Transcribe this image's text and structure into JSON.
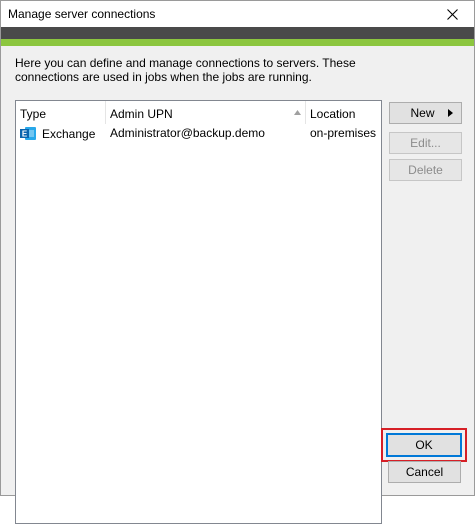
{
  "window": {
    "title": "Manage server connections",
    "close_label": "Close"
  },
  "colors": {
    "banner_dark": "#4a4a4a",
    "banner_green": "#8cc63f",
    "highlight": "#d61f26",
    "focus_border": "#0078d7"
  },
  "description": "Here you can define and manage connections to servers. These connections are used in jobs when the jobs are running.",
  "list": {
    "columns": [
      "Type",
      "Admin UPN",
      "Location"
    ],
    "sorted_column": "Admin UPN",
    "rows": [
      {
        "type": "Exchange",
        "icon": "exchange-icon",
        "admin_upn": "Administrator@backup.demo",
        "location": "on-premises"
      }
    ]
  },
  "buttons": {
    "new": "New",
    "edit": "Edit...",
    "delete": "Delete",
    "ok": "OK",
    "cancel": "Cancel"
  }
}
